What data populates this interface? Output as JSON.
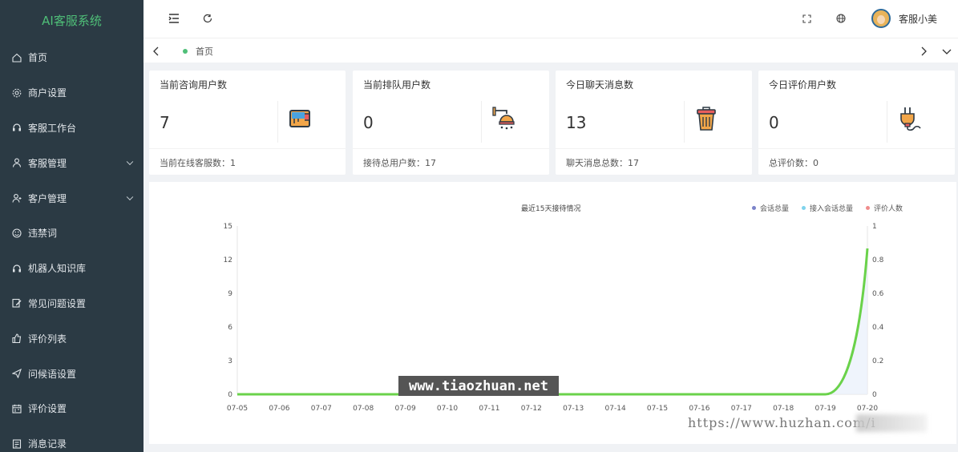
{
  "sidebar": {
    "brand": "AI客服系统",
    "items": [
      {
        "label": "首页",
        "icon": "home-icon",
        "expandable": false
      },
      {
        "label": "商户设置",
        "icon": "gear-icon",
        "expandable": false
      },
      {
        "label": "客服工作台",
        "icon": "headset-icon",
        "expandable": false
      },
      {
        "label": "客服管理",
        "icon": "user-icon",
        "expandable": true
      },
      {
        "label": "客户管理",
        "icon": "users-icon",
        "expandable": true
      },
      {
        "label": "违禁词",
        "icon": "smile-icon",
        "expandable": false
      },
      {
        "label": "机器人知识库",
        "icon": "headset-icon",
        "expandable": false
      },
      {
        "label": "常见问题设置",
        "icon": "edit-icon",
        "expandable": false
      },
      {
        "label": "评价列表",
        "icon": "thumbs-up-icon",
        "expandable": false
      },
      {
        "label": "问候语设置",
        "icon": "send-icon",
        "expandable": false
      },
      {
        "label": "评价设置",
        "icon": "calendar-icon",
        "expandable": false
      },
      {
        "label": "消息记录",
        "icon": "message-icon",
        "expandable": false
      }
    ]
  },
  "header": {
    "user_name": "客服小美"
  },
  "tabs": [
    {
      "label": "首页",
      "active": true
    }
  ],
  "cards": [
    {
      "title": "当前咨询用户数",
      "value": "7",
      "footer": "当前在线客服数：1",
      "icon": "paint-bucket-icon"
    },
    {
      "title": "当前排队用户数",
      "value": "0",
      "footer": "接待总用户数：17",
      "icon": "shower-icon"
    },
    {
      "title": "今日聊天消息数",
      "value": "13",
      "footer": "聊天消息总数：17",
      "icon": "trash-bin-icon"
    },
    {
      "title": "今日评价用户数",
      "value": "0",
      "footer": "总评价数：0",
      "icon": "plug-icon"
    }
  ],
  "chart_data": {
    "type": "line",
    "title": "最近15天接待情况",
    "categories": [
      "07-05",
      "07-06",
      "07-07",
      "07-08",
      "07-09",
      "07-10",
      "07-11",
      "07-12",
      "07-13",
      "07-14",
      "07-15",
      "07-16",
      "07-17",
      "07-18",
      "07-19",
      "07-20"
    ],
    "y_left_ticks": [
      "0",
      "3",
      "6",
      "9",
      "12",
      "15"
    ],
    "y_right_ticks": [
      "0",
      "0.2",
      "0.4",
      "0.6",
      "0.8",
      "1"
    ],
    "ylim_left": [
      0,
      15
    ],
    "ylim_right": [
      0,
      1
    ],
    "grid": false,
    "legend_position": "top-right",
    "series": [
      {
        "name": "会话总量",
        "color": "#7b83c9",
        "values": [
          0,
          0,
          0,
          0,
          0,
          0,
          0,
          0,
          0,
          0,
          0,
          0,
          0,
          0,
          0,
          0
        ]
      },
      {
        "name": "接入会话总量",
        "color": "#7fd3ec",
        "values": [
          0,
          0,
          0,
          0,
          0,
          0,
          0,
          0,
          0,
          0,
          0,
          0,
          0,
          0,
          0,
          0
        ]
      },
      {
        "name": "评价人数",
        "color": "#f08c8c",
        "values": [
          0,
          0,
          0,
          0,
          0,
          0,
          0,
          0,
          0,
          0,
          0,
          0,
          0,
          0,
          0,
          0
        ]
      }
    ],
    "highlight_series": {
      "color": "#6ad24a",
      "values": [
        0,
        0,
        0,
        0,
        0,
        0,
        0,
        0,
        0,
        0,
        0,
        0,
        0,
        0,
        0,
        13
      ]
    }
  },
  "watermarks": {
    "banner": "www.tiaozhuan.net",
    "corner": "https://www.huzhan.com/i"
  }
}
